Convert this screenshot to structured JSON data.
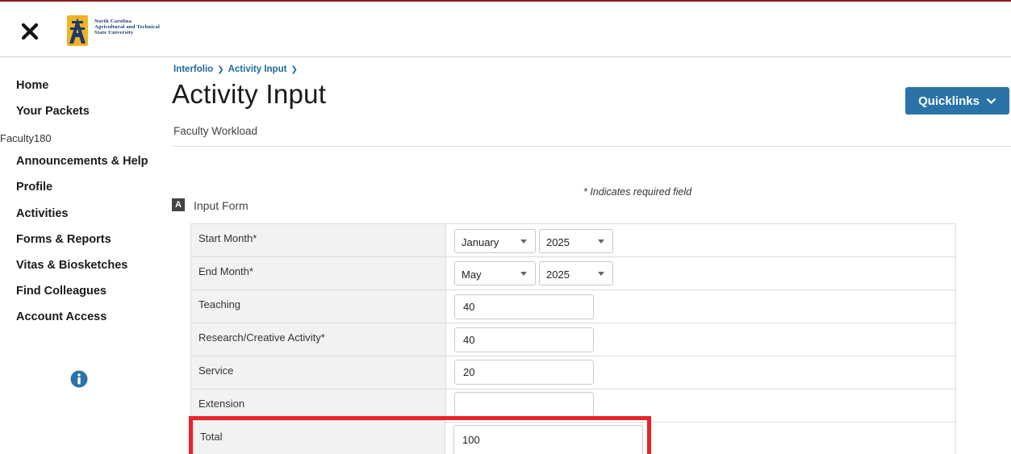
{
  "brand": {
    "logo_lines": [
      "North Carolina",
      "Agricultural and Technical",
      "State University"
    ],
    "accent": "#8a1c22",
    "link_color": "#1c6a9c",
    "button_color": "#2a73a9",
    "highlight_color": "#e8232a"
  },
  "header": {
    "close_icon": "close-icon"
  },
  "sidebar": {
    "items_top": [
      {
        "label": "Home"
      },
      {
        "label": "Your Packets"
      }
    ],
    "section_label": "Faculty180",
    "items": [
      {
        "label": "Announcements & Help"
      },
      {
        "label": "Profile"
      },
      {
        "label": "Activities"
      },
      {
        "label": "Forms & Reports"
      },
      {
        "label": "Vitas & Biosketches"
      },
      {
        "label": "Find Colleagues"
      },
      {
        "label": "Account Access"
      }
    ],
    "info_icon": "info-icon"
  },
  "breadcrumb": [
    "Interfolio",
    "Activity Input"
  ],
  "page": {
    "title": "Activity Input",
    "subtitle": "Faculty Workload",
    "quicklinks_label": "Quicklinks",
    "required_note": "* Indicates required field"
  },
  "form": {
    "section_letter": "A",
    "section_title": "Input Form",
    "start_month": {
      "label": "Start Month*",
      "month": "January",
      "year": "2025"
    },
    "end_month": {
      "label": "End Month*",
      "month": "May",
      "year": "2025"
    },
    "teaching": {
      "label": "Teaching",
      "value": "40"
    },
    "research": {
      "label": "Research/Creative Activity*",
      "value": "40"
    },
    "service": {
      "label": "Service",
      "value": "20"
    },
    "extension": {
      "label": "Extension",
      "value": ""
    },
    "total": {
      "label": "Total",
      "value": "100"
    }
  }
}
